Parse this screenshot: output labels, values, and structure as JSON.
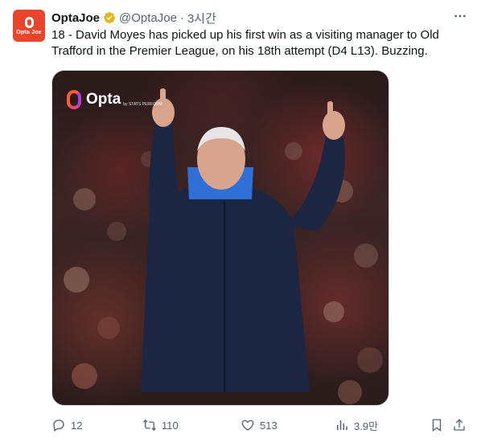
{
  "author": {
    "avatar_label": "Opta Joe",
    "name": "OptaJoe",
    "handle": "@OptaJoe",
    "separator": "·",
    "time": "3시간",
    "verified": true
  },
  "tweet": {
    "text": "18 - David Moyes has picked up his first win as a visiting manager to Old Trafford in the Premier League, on his 18th attempt (D4 L13). Buzzing."
  },
  "media": {
    "badge_word": "Opta",
    "badge_sub": "by STATS PERFORM"
  },
  "actions": {
    "replies": "12",
    "retweets": "110",
    "likes": "513",
    "views": "3.9만"
  },
  "colors": {
    "text": "#0f1419",
    "secondary": "#536471",
    "avatar_bg": "#e8452c",
    "verified": "#e2b719"
  },
  "icons": [
    "verified-badge-icon",
    "more-icon",
    "reply-icon",
    "retweet-icon",
    "like-icon",
    "views-icon",
    "bookmark-icon",
    "share-icon"
  ]
}
